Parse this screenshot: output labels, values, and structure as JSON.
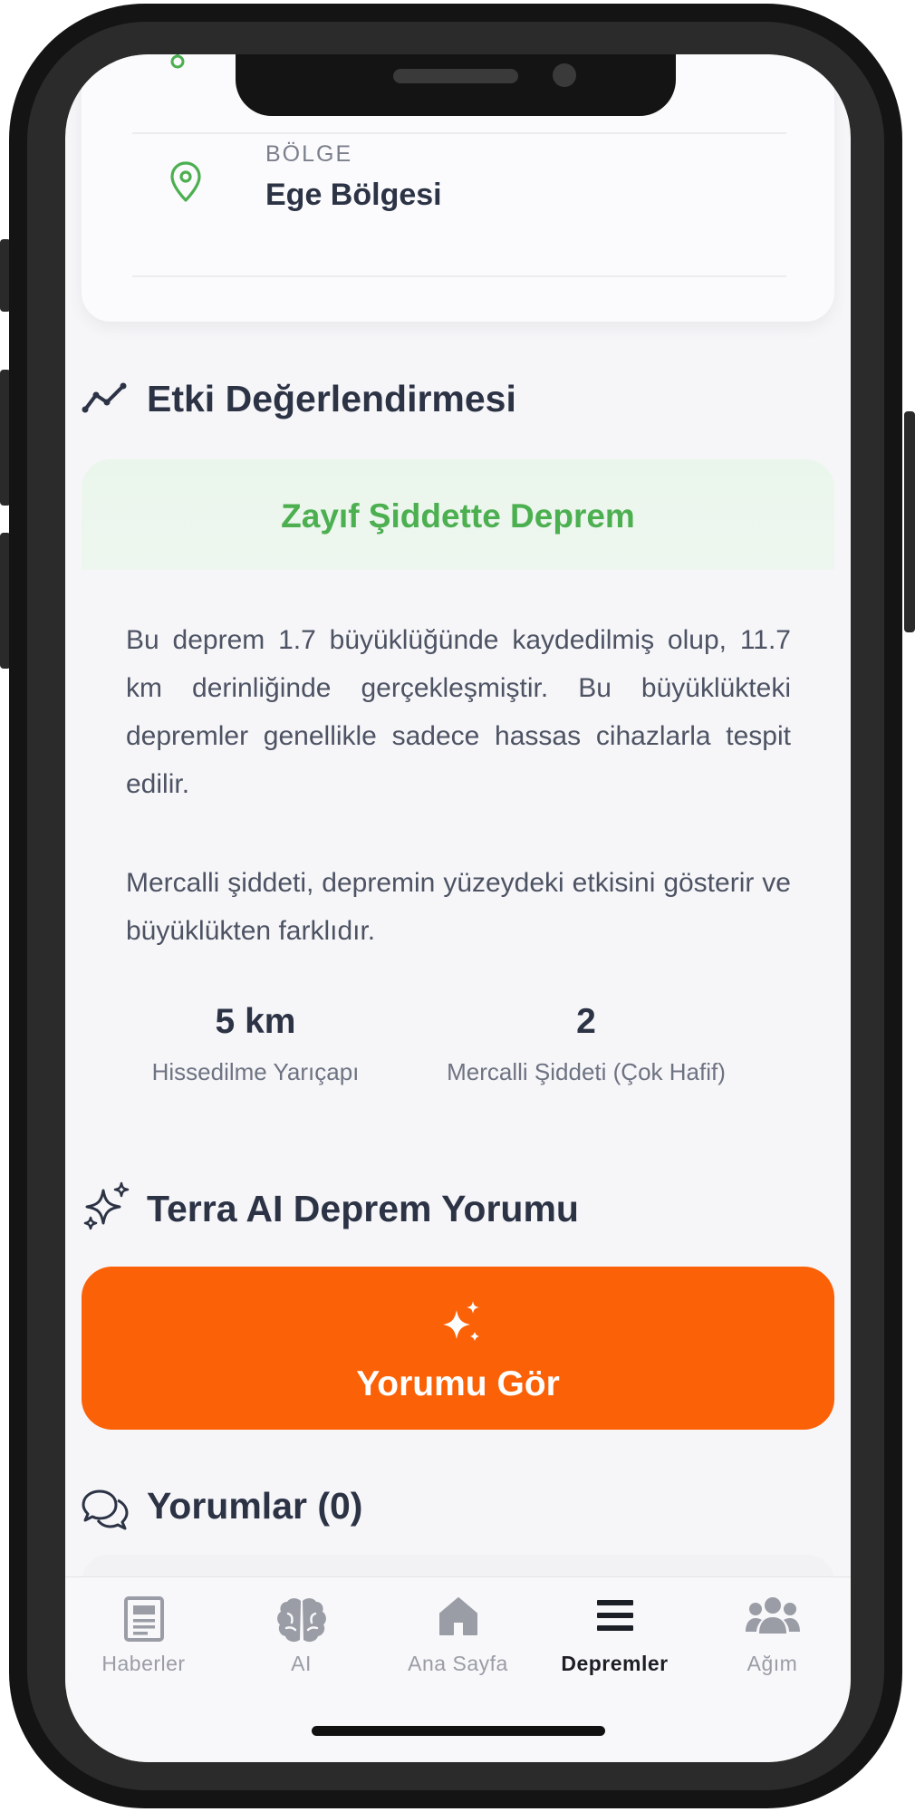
{
  "location": {
    "label": "BÖLGE",
    "value": "Ege Bölgesi"
  },
  "impact": {
    "section_title": "Etki Değerlendirmesi",
    "headline": "Zayıf Şiddette Deprem",
    "description_1": "Bu deprem 1.7 büyüklüğünde kaydedilmiş olup, 11.7 km derinliğinde gerçekleşmiştir. Bu büyüklükteki depremler genellikle sadece hassas cihazlarla tespit edilir.",
    "description_2": "Mercalli şiddeti, depremin yüzeydeki etkisini gösterir ve büyüklükten farklıdır.",
    "stats": [
      {
        "value": "5 km",
        "label": "Hissedilme Yarıçapı"
      },
      {
        "value": "2",
        "label": "Mercalli Şiddeti (Çok Hafif)"
      }
    ]
  },
  "ai": {
    "section_title": "Terra AI Deprem Yorumu",
    "button_label": "Yorumu Gör"
  },
  "comments": {
    "section_title": "Yorumlar (0)"
  },
  "tabbar": {
    "items": [
      {
        "label": "Haberler",
        "icon": "newspaper-icon"
      },
      {
        "label": "AI",
        "icon": "brain-icon"
      },
      {
        "label": "Ana Sayfa",
        "icon": "home-icon"
      },
      {
        "label": "Depremler",
        "icon": "list-icon",
        "active": true
      },
      {
        "label": "Ağım",
        "icon": "people-icon"
      }
    ]
  },
  "colors": {
    "accent_green": "#4caf50",
    "button_orange": "#fb6106",
    "text_dark": "#2c3345"
  }
}
